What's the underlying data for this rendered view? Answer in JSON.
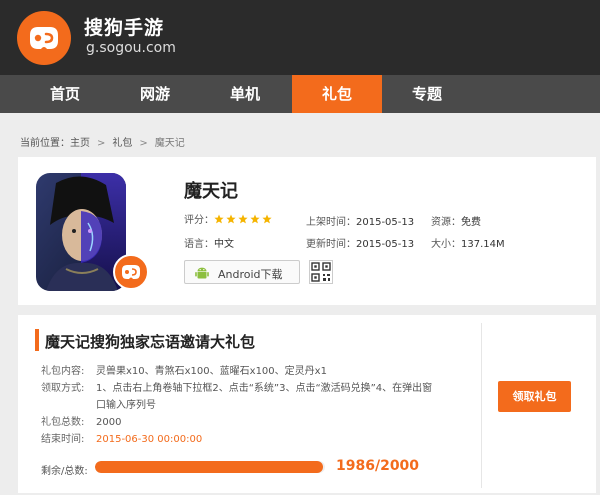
{
  "header": {
    "site_name": "搜狗手游",
    "site_url": "g.sogou.com",
    "brand_color": "#f36b1c"
  },
  "nav": {
    "items": [
      "首页",
      "网游",
      "单机",
      "礼包",
      "专题"
    ],
    "active_index": 3
  },
  "breadcrumb": {
    "prefix": "当前位置：",
    "items": [
      "主页",
      "礼包",
      "魔天记"
    ]
  },
  "game": {
    "title": "魔天记",
    "rating_label": "评分：",
    "rating_stars": 5,
    "language_label": "语言：",
    "language": "中文",
    "release_label": "上架时间：",
    "release_date": "2015-05-13",
    "update_label": "更新时间：",
    "update_date": "2015-05-13",
    "price_label": "资源：",
    "price": "免费",
    "size_label": "大小：",
    "size": "137.14M",
    "download_label": "Android下载",
    "icons": {
      "download": "android-icon",
      "qr": "qr-code-icon",
      "badge": "sogou-gamepad-icon"
    }
  },
  "gift": {
    "title": "魔天记搜狗独家忘语邀请大礼包",
    "content_label": "礼包内容:",
    "content": "灵兽果x10、青煞石x100、蓝曜石x100、定灵丹x1",
    "method_label": "领取方式:",
    "method_line1": "1、点击右上角卷轴下拉框2、点击“系统”3、点击“激活码兑换”4、在弹出窗",
    "method_line2": "口输入序列号",
    "total_label": "礼包总数:",
    "total": "2000",
    "end_label": "结束时间:",
    "end_time": "2015-06-30 00:00:00",
    "remaining_label": "剩余/总数:",
    "remaining_value": "1986/2000",
    "remaining_fraction": 0.993,
    "claim_label": "领取礼包"
  }
}
